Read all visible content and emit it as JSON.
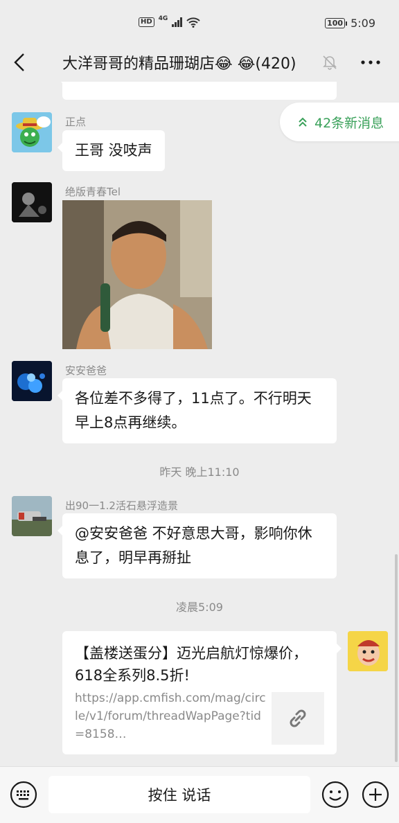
{
  "status_bar": {
    "hd": "HD",
    "network": "4G",
    "battery": "100",
    "time": "5:09"
  },
  "header": {
    "title": "大洋哥哥的精品珊瑚店😂 😂(420)"
  },
  "new_messages": {
    "label": "42条新消息"
  },
  "messages": [
    {
      "sender": "正点",
      "text": "王哥 没吱声"
    },
    {
      "sender": "绝版青春Tel"
    },
    {
      "sender": "安安爸爸",
      "text": "各位差不多得了，11点了。不行明天早上8点再继续。"
    },
    {
      "sender": "出90一1.2活石悬浮造景",
      "text": "@安安爸爸  不好意思大哥，影响你休息了，明早再掰扯"
    }
  ],
  "time_labels": {
    "yesterday": "昨天 晚上11:10",
    "dawn": "凌晨5:09"
  },
  "link_card": {
    "title": "【盖楼送蛋分】迈光启航灯惊爆价，618全系列8.5折!",
    "url": "https://app.cmfish.com/mag/circle/v1/forum/threadWapPage?tid=8158…"
  },
  "input_bar": {
    "hold_to_talk": "按住 说话"
  }
}
